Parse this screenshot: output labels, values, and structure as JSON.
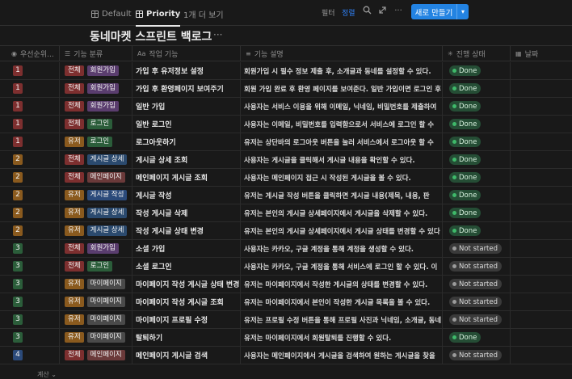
{
  "views": [
    {
      "label": "Default",
      "icon": "table-icon"
    },
    {
      "label": "Priority",
      "icon": "table-icon"
    }
  ],
  "more_views": "1개 더 보기",
  "toolbar": {
    "filter": "필터",
    "sort": "정렬",
    "search_icon": "search-icon",
    "expand_icon": "expand-icon",
    "more_icon": "more-icon",
    "new_label": "새로 만들기",
    "accent": "#2383e2"
  },
  "page": {
    "title": "동네마켓 스프린트 백로그",
    "more": "···"
  },
  "columns": [
    {
      "label": "우선순위...",
      "icon": "select-icon"
    },
    {
      "label": "기능 분류",
      "icon": "list-icon"
    },
    {
      "label": "작업 기능",
      "icon": "text-icon"
    },
    {
      "label": "기능 설명",
      "icon": "lines-icon"
    },
    {
      "label": "진행 상태",
      "icon": "status-icon"
    },
    {
      "label": "날짜",
      "icon": "calendar-icon"
    }
  ],
  "colors": {
    "priority": {
      "1": "#7d2f2f",
      "2": "#8a5a1e",
      "3": "#2b5d3a",
      "4": "#2b4a7a"
    },
    "tags": {
      "전체": "#7d2f2f",
      "유저": "#8a5a1e",
      "회원가입": "#5a3d6e",
      "로그인": "#2b5d3a",
      "게시글 상세": "#2b4a6e",
      "메인페이지": "#6b3a3a",
      "게시글 작성": "#2b4a7a",
      "마이페이지": "#4a4a4a"
    },
    "done_bg": "#254d35",
    "done_dot": "#3fb96a",
    "not_started_bg": "#3a3a3a",
    "not_started_dot": "#9b9b9b"
  },
  "rows": [
    {
      "priority": "1",
      "scope": "전체",
      "category": "회원가입",
      "title": "가입 후 유저정보 설정",
      "description": "회원가입 시 필수 정보 제출 후, 소개글과 동네를 설정할 수 있다.",
      "status": "Done"
    },
    {
      "priority": "1",
      "scope": "전체",
      "category": "회원가입",
      "title": "가입 후 환영페이지 보여주기",
      "description": "회원 가입 완료 후 환영 페이지를 보여준다. 일반 가입이면 로그인 후",
      "status": "Done"
    },
    {
      "priority": "1",
      "scope": "전체",
      "category": "회원가입",
      "title": "일반 가입",
      "description": "사용자는 서비스 이용을 위해 이메일, 닉네임, 비밀번호를 제출하여",
      "status": "Done"
    },
    {
      "priority": "1",
      "scope": "전체",
      "category": "로그인",
      "title": "일반 로그인",
      "description": "사용자는 이메일, 비밀번호를 입력함으로서 서비스에 로그인 할 수",
      "status": "Done"
    },
    {
      "priority": "1",
      "scope": "유저",
      "category": "로그인",
      "title": "로그아웃하기",
      "description": "유저는 상단바의 로그아웃 버튼을 눌러 서비스에서 로그아웃 할 수",
      "status": "Done"
    },
    {
      "priority": "2",
      "scope": "전체",
      "category": "게시글 상세",
      "title": "게시글 상세 조회",
      "description": "사용자는 게시글을 클릭해서 게시글 내용을 확인할 수 있다.",
      "status": "Done"
    },
    {
      "priority": "2",
      "scope": "전체",
      "category": "메인페이지",
      "title": "메인페이지 게시글 조회",
      "description": "사용자는 메인페이지 접근 시 작성된 게시글을 볼 수 있다.",
      "status": "Done"
    },
    {
      "priority": "2",
      "scope": "유저",
      "category": "게시글 작성",
      "title": "게시글 작성",
      "description": "유저는 게시글 작성 버튼을 클릭하면 게시글 내용(제목, 내용, 판",
      "status": "Done"
    },
    {
      "priority": "2",
      "scope": "유저",
      "category": "게시글 상세",
      "title": "작성 게시글 삭제",
      "description": "유저는 본인의 게시글 상세페이지에서 게시글을 삭제할 수 있다.",
      "status": "Done"
    },
    {
      "priority": "2",
      "scope": "유저",
      "category": "게시글 상세",
      "title": "작성 게시글 상태 변경",
      "description": "유저는 본인의 게시글 상세페이지에서 게시글 상태를 변경할 수 있다",
      "status": "Done"
    },
    {
      "priority": "3",
      "scope": "전체",
      "category": "회원가입",
      "title": "소셜 가입",
      "description": "사용자는 카카오, 구글 계정을 통해 계정을 생성할 수 있다.",
      "status": "Not started"
    },
    {
      "priority": "3",
      "scope": "전체",
      "category": "로그인",
      "title": "소셜 로그인",
      "description": "사용자는 카카오, 구글 계정을 통해 서비스에 로그인 할 수 있다. 이",
      "status": "Not started"
    },
    {
      "priority": "3",
      "scope": "유저",
      "category": "마이페이지",
      "title": "마이페이지 작성 게시글 상태 변경",
      "description": "유저는 마이페이지에서 작성한 게시글의 상태를 변경할 수 있다.",
      "status": "Not started"
    },
    {
      "priority": "3",
      "scope": "유저",
      "category": "마이페이지",
      "title": "마이페이지 작성 게시글 조회",
      "description": "유저는 마이페이지에서 본인이 작성한 게시글 목록을 볼 수 있다.",
      "status": "Not started"
    },
    {
      "priority": "3",
      "scope": "유저",
      "category": "마이페이지",
      "title": "마이페이지 프로필 수정",
      "description": "유저는 프로필 수정 버튼을 통해 프로필 사진과 닉네임, 소개글, 동네",
      "status": "Not started"
    },
    {
      "priority": "3",
      "scope": "유저",
      "category": "마이페이지",
      "title": "탈퇴하기",
      "description": "유저는 마이페이지에서 회원탈퇴를 진행할 수 있다.",
      "status": "Done"
    },
    {
      "priority": "4",
      "scope": "전체",
      "category": "메인페이지",
      "title": "메인페이지 게시글 검색",
      "description": "사용자는 메인페이지에서 게시글을 검색하여 원하는 게시글을 찾을",
      "status": "Not started"
    }
  ],
  "footer": {
    "calc_label": "계산 ⌄"
  }
}
